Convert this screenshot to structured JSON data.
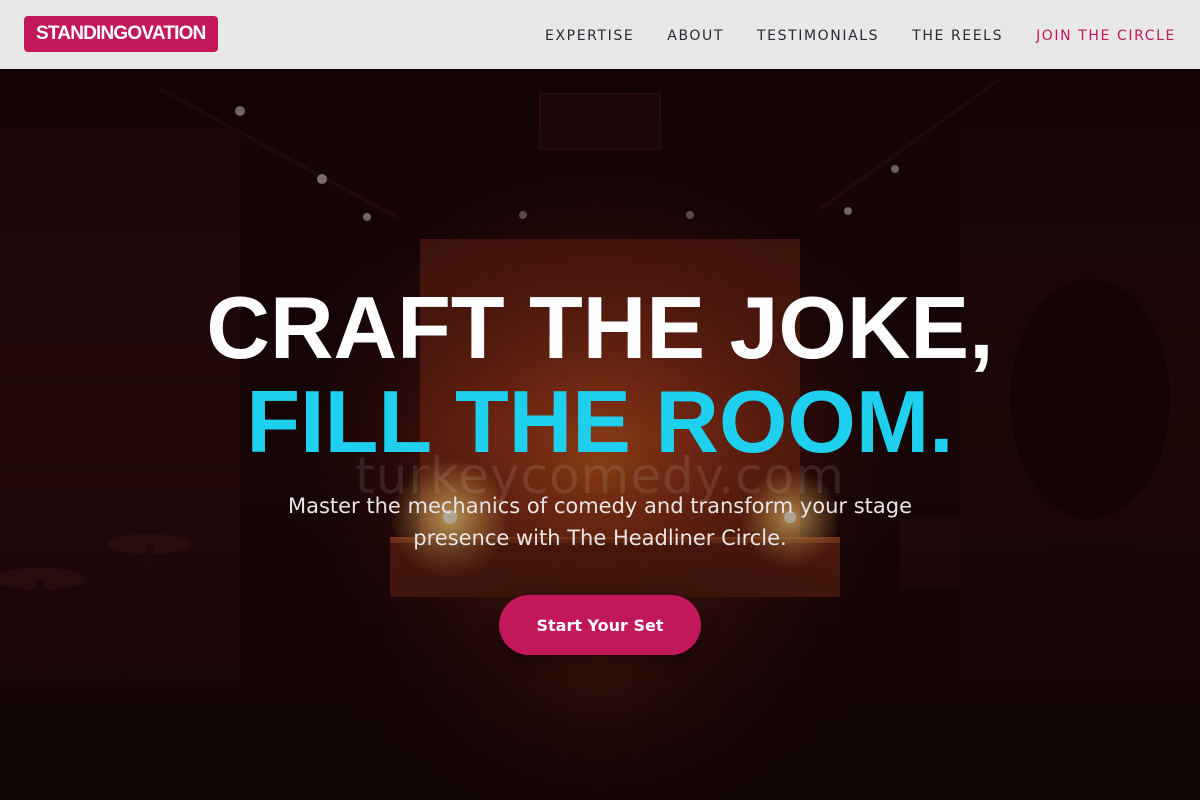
{
  "brand": {
    "logo_text": "STANDINGOVATION"
  },
  "nav": {
    "items": [
      {
        "label": "EXPERTISE"
      },
      {
        "label": "ABOUT"
      },
      {
        "label": "TESTIMONIALS"
      },
      {
        "label": "THE REELS"
      },
      {
        "label": "JOIN THE CIRCLE"
      }
    ]
  },
  "hero": {
    "headline_line1": "CRAFT THE JOKE,",
    "headline_line2": "FILL THE ROOM.",
    "watermark": "turkeycomedy.com",
    "subtitle": "Master the mechanics of comedy and transform your stage presence with The Headliner Circle.",
    "cta_label": "Start Your Set",
    "background_image": "dim comedy club stage with spotlight and empty tables"
  },
  "colors": {
    "brand": "#c2185b",
    "accent": "#1fd0ee",
    "nav_bg": "#e8e8e8",
    "nav_text": "#2a2a33",
    "headline": "#ffffff"
  }
}
